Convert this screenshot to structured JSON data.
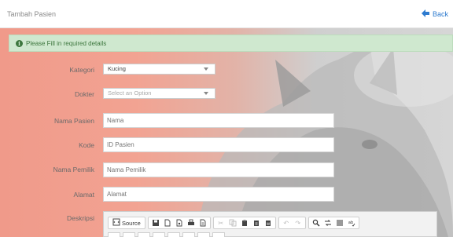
{
  "header": {
    "title": "Tambah Pasien",
    "back_label": "Back"
  },
  "alert": {
    "message": "Please Fill in required details"
  },
  "form": {
    "kategori": {
      "label": "Kategori",
      "value": "Kucing"
    },
    "dokter": {
      "label": "Dokter",
      "placeholder": "Select an Option"
    },
    "nama_pasien": {
      "label": "Nama Pasien",
      "placeholder": "Nama"
    },
    "kode": {
      "label": "Kode",
      "placeholder": "ID Pasien"
    },
    "nama_pemilik": {
      "label": "Nama Pemilik",
      "placeholder": "Nama Pemilik"
    },
    "alamat": {
      "label": "Alamat",
      "placeholder": "Alamat"
    },
    "deskripsi": {
      "label": "Deskripsi"
    }
  },
  "editor": {
    "source_label": "Source",
    "tools": [
      "source",
      "save",
      "new-page",
      "preview",
      "print",
      "templates",
      "cut",
      "copy",
      "paste",
      "paste-text",
      "paste-word",
      "undo",
      "redo",
      "find",
      "replace",
      "select-all",
      "spellcheck"
    ]
  },
  "colors": {
    "accent": "#2e7bcf",
    "alert_bg": "#cfe8cf",
    "alert_text": "#3c763d",
    "background_warm": "#f09a8a"
  }
}
